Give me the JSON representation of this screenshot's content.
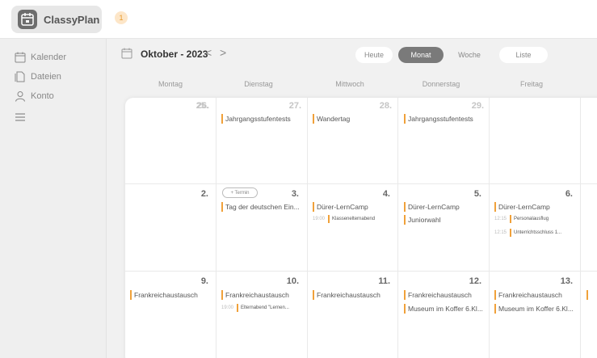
{
  "app": {
    "name": "ClassyPlan",
    "notification_count": "1"
  },
  "sidebar": {
    "items": [
      {
        "label": "Kalender",
        "icon": "calendar-icon"
      },
      {
        "label": "Dateien",
        "icon": "files-icon"
      },
      {
        "label": "Konto",
        "icon": "user-icon"
      }
    ],
    "menu_icon": "hamburger-icon"
  },
  "toolbar": {
    "month_label": "Oktober - 2023",
    "prev": "<",
    "next": ">",
    "today": "Heute",
    "views": [
      "Monat",
      "Woche",
      "Liste"
    ],
    "active_view": "Monat"
  },
  "weekdays": [
    "Montag",
    "Dienstag",
    "Mittwoch",
    "Donnerstag",
    "Freitag"
  ],
  "weeks": [
    {
      "days": [
        {
          "num": "25.",
          "past": true,
          "events": []
        },
        {
          "num": "26.",
          "past": true,
          "events": [
            "Jahrgangsstufentests"
          ]
        },
        {
          "num": "27.",
          "past": true,
          "events": [
            "Wandertag"
          ]
        },
        {
          "num": "28.",
          "past": true,
          "events": [
            "Jahrgangsstufentests"
          ]
        },
        {
          "num": "29.",
          "past": true,
          "events": []
        }
      ]
    },
    {
      "days": [
        {
          "num": "2.",
          "past": false,
          "events": []
        },
        {
          "num": "3.",
          "past": false,
          "termin": "+ Termin",
          "events": [
            "Tag der deutschen Ein..."
          ]
        },
        {
          "num": "4.",
          "past": false,
          "events": [
            "Dürer-LernCamp"
          ],
          "timed": [
            {
              "time": "19:00",
              "title": "Klassenelternabend"
            }
          ]
        },
        {
          "num": "5.",
          "past": false,
          "events": [
            "Dürer-LernCamp",
            "Juniorwahl"
          ]
        },
        {
          "num": "6.",
          "past": false,
          "events": [
            "Dürer-LernCamp"
          ],
          "timed": [
            {
              "time": "12:15",
              "title": "Personalausflug"
            },
            {
              "time": "12:15",
              "title": "Unterrichtsschluss 1..."
            }
          ]
        }
      ]
    },
    {
      "days": [
        {
          "num": "9.",
          "past": false,
          "events": [
            "Frankreichaustausch"
          ]
        },
        {
          "num": "10.",
          "past": false,
          "events": [
            "Frankreichaustausch"
          ],
          "timed": [
            {
              "time": "19:00",
              "title": "Elternabend \"Lernen..."
            }
          ]
        },
        {
          "num": "11.",
          "past": false,
          "events": [
            "Frankreichaustausch"
          ]
        },
        {
          "num": "12.",
          "past": false,
          "events": [
            "Frankreichaustausch",
            "Museum im Koffer 6.Kl..."
          ]
        },
        {
          "num": "13.",
          "past": false,
          "events": [
            "Frankreichaustausch",
            "Museum im Koffer 6.Kl..."
          ]
        }
      ]
    }
  ],
  "colors": {
    "accent": "#f0a13a",
    "active_button": "#7a7a7a"
  }
}
